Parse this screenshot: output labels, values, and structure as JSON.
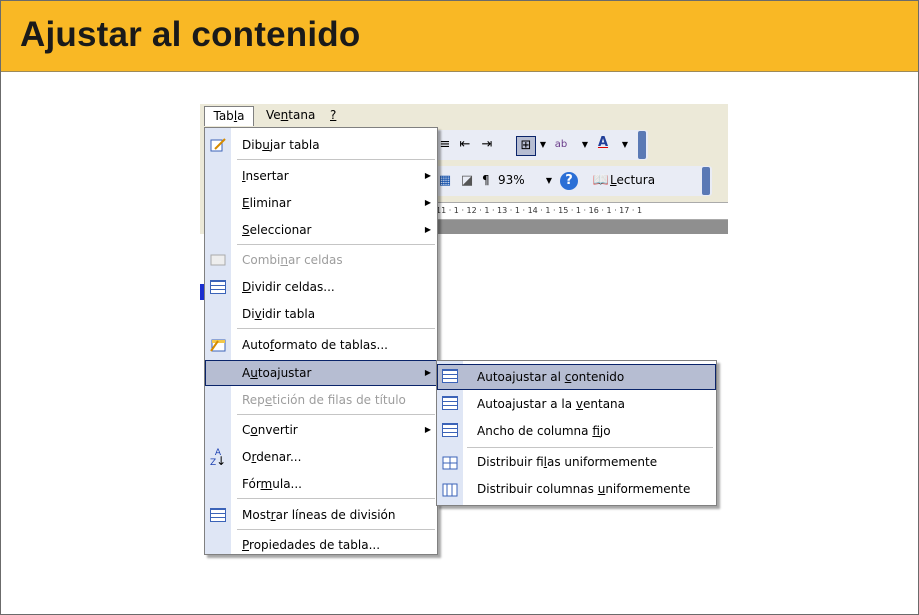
{
  "slide": {
    "title": "Ajustar al contenido"
  },
  "menubar": {
    "tabla": "Tabla",
    "ventana": "Ventana",
    "help": "?"
  },
  "toolbar": {
    "zoom": "93%",
    "lectura": "Lectura",
    "para": "¶"
  },
  "ruler": {
    "text": "11 · 1 · 12 · 1 · 13 · 1 · 14 · 1 · 15 · 1 · 16 · 1 · 17 · 1"
  },
  "menu": {
    "items": [
      {
        "label": "Dibujar tabla",
        "icon": "pencil-table-icon"
      },
      {
        "label": "Insertar",
        "submenu": true
      },
      {
        "label": "Eliminar",
        "submenu": true
      },
      {
        "label": "Seleccionar",
        "submenu": true
      },
      {
        "label": "Combinar celdas",
        "disabled": true,
        "icon": "merge-cells-icon"
      },
      {
        "label": "Dividir celdas...",
        "icon": "split-cells-icon"
      },
      {
        "label": "Dividir tabla"
      },
      {
        "label": "Autoformato de tablas...",
        "icon": "autoformat-icon"
      },
      {
        "label": "Autoajustar",
        "submenu": true,
        "highlighted": true
      },
      {
        "label": "Repetición de filas de título",
        "disabled": true
      },
      {
        "label": "Convertir",
        "submenu": true
      },
      {
        "label": "Ordenar...",
        "icon": "sort-az-icon"
      },
      {
        "label": "Fórmula..."
      },
      {
        "label": "Mostrar líneas de división",
        "icon": "gridlines-icon"
      },
      {
        "label": "Propiedades de tabla..."
      }
    ]
  },
  "submenu": {
    "items": [
      {
        "label": "Autoajustar al contenido",
        "highlighted": true
      },
      {
        "label": "Autoajustar a la ventana"
      },
      {
        "label": "Ancho de columna fijo"
      },
      {
        "label": "Distribuir filas uniformemente"
      },
      {
        "label": "Distribuir columnas uniformemente"
      }
    ]
  }
}
